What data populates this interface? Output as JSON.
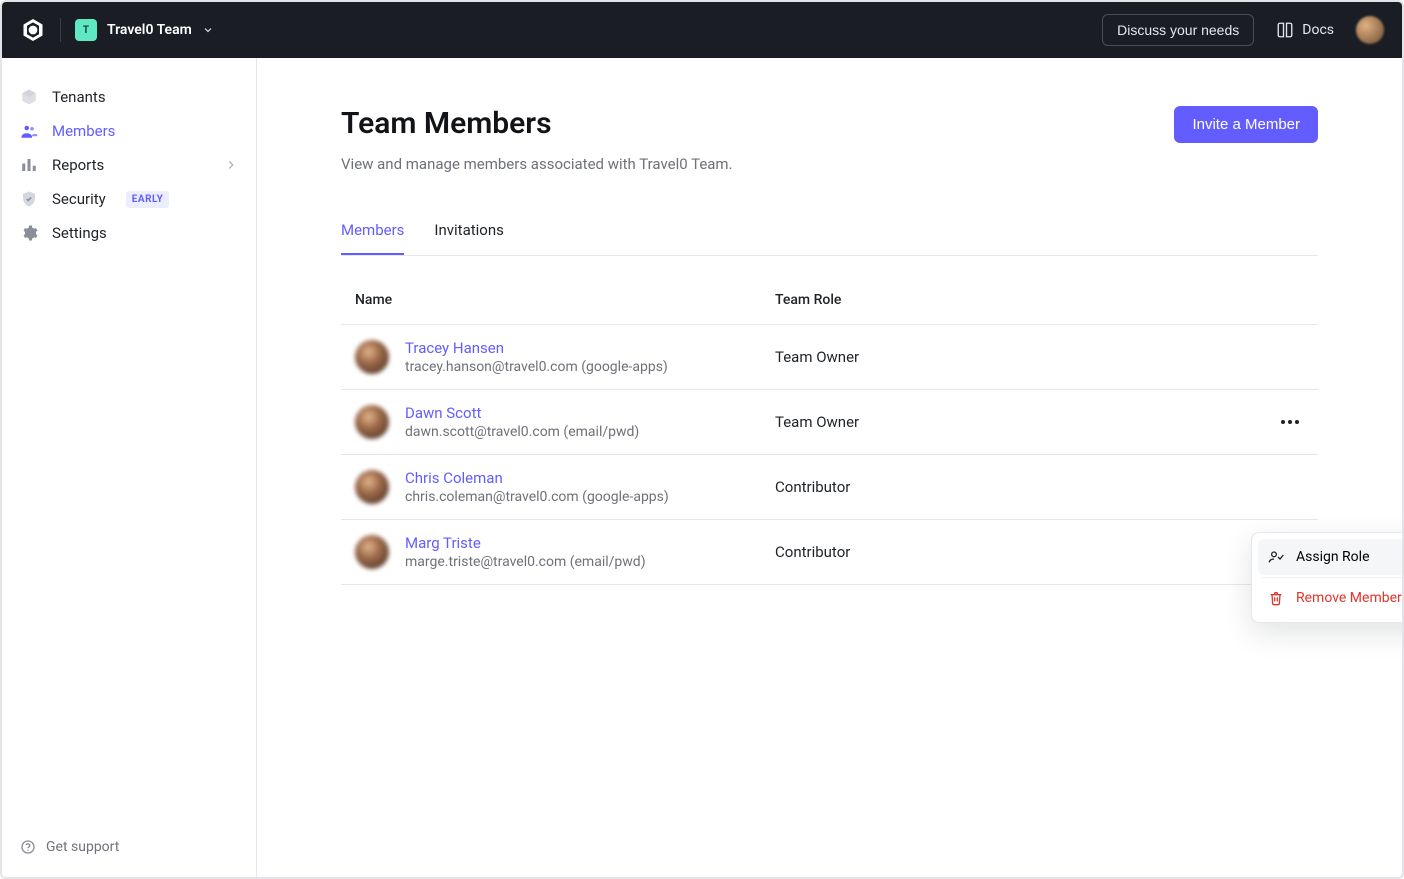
{
  "header": {
    "team_badge_letter": "T",
    "team_name": "Travel0 Team",
    "discuss_label": "Discuss your needs",
    "docs_label": "Docs"
  },
  "sidebar": {
    "items": [
      {
        "label": "Tenants"
      },
      {
        "label": "Members"
      },
      {
        "label": "Reports"
      },
      {
        "label": "Security",
        "badge": "EARLY"
      },
      {
        "label": "Settings"
      }
    ],
    "support_label": "Get support"
  },
  "page": {
    "title": "Team Members",
    "subtitle": "View and manage members associated with Travel0 Team.",
    "invite_label": "Invite a Member"
  },
  "tabs": [
    {
      "label": "Members",
      "active": true
    },
    {
      "label": "Invitations",
      "active": false
    }
  ],
  "table": {
    "columns": {
      "name": "Name",
      "role": "Team Role"
    },
    "rows": [
      {
        "name": "Tracey Hansen",
        "email": "tracey.hanson@travel0.com (google-apps)",
        "role": "Team Owner",
        "has_menu": false
      },
      {
        "name": "Dawn Scott",
        "email": "dawn.scott@travel0.com (email/pwd)",
        "role": "Team Owner",
        "has_menu": true
      },
      {
        "name": "Chris Coleman",
        "email": "chris.coleman@travel0.com (google-apps)",
        "role": "Contributor",
        "has_menu": false
      },
      {
        "name": "Marg Triste",
        "email": "marge.triste@travel0.com (email/pwd)",
        "role": "Contributor",
        "has_menu": true
      }
    ]
  },
  "context_menu": {
    "assign_label": "Assign Role",
    "remove_label": "Remove Member"
  }
}
